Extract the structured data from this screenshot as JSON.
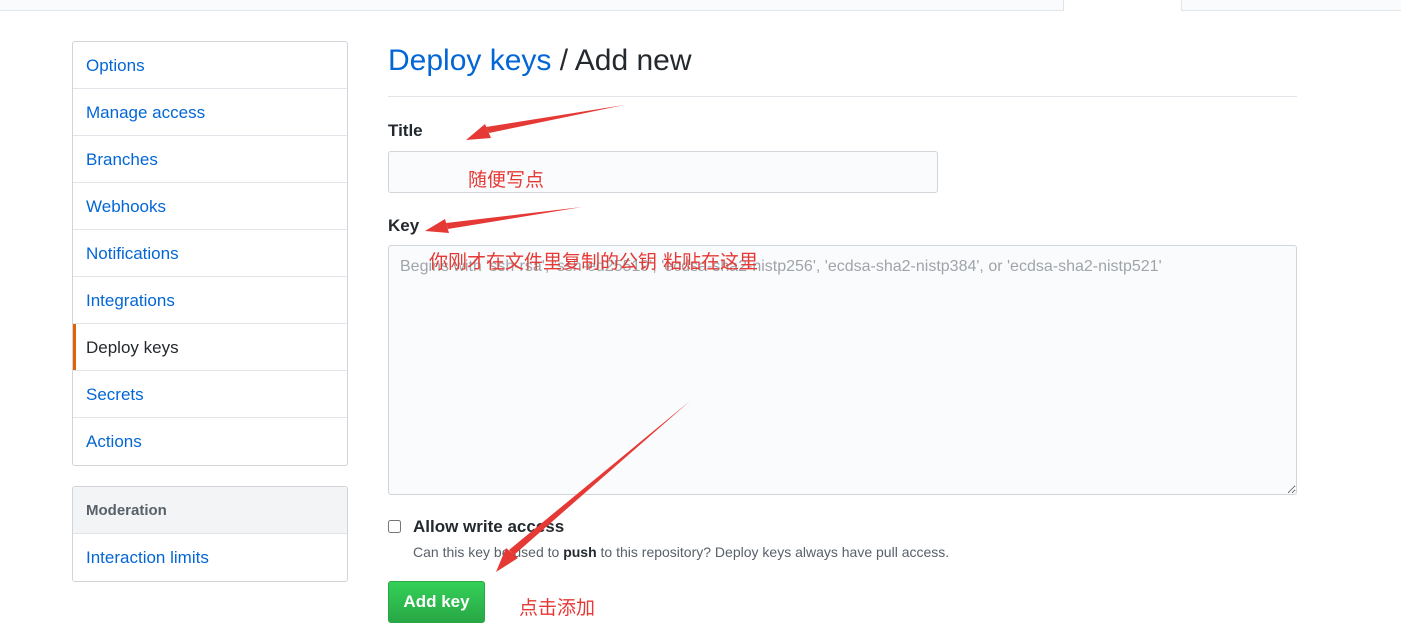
{
  "sidebar": {
    "items": [
      {
        "label": "Options"
      },
      {
        "label": "Manage access"
      },
      {
        "label": "Branches"
      },
      {
        "label": "Webhooks"
      },
      {
        "label": "Notifications"
      },
      {
        "label": "Integrations"
      },
      {
        "label": "Deploy keys"
      },
      {
        "label": "Secrets"
      },
      {
        "label": "Actions"
      }
    ],
    "selected": "Deploy keys",
    "moderation": {
      "heading": "Moderation",
      "items": [
        {
          "label": "Interaction limits"
        }
      ]
    }
  },
  "main": {
    "breadcrumb": "Deploy keys",
    "separator": "/",
    "title": "Add new",
    "title_field": {
      "label": "Title",
      "value": ""
    },
    "key_field": {
      "label": "Key",
      "placeholder": "Begins with 'ssh-rsa', 'ssh-ed25519', 'ecdsa-sha2-nistp256', 'ecdsa-sha2-nistp384', or 'ecdsa-sha2-nistp521'",
      "value": ""
    },
    "write_access": {
      "label": "Allow write access",
      "checked": false,
      "note_prefix": "Can this key be used to",
      "note_bold": "push",
      "note_suffix": "to this repository? Deploy keys always have pull access."
    },
    "submit_label": "Add key"
  },
  "annotations": {
    "title_hint": "随便写点",
    "key_hint": "你刚才在文件里复制的公钥 粘贴在这里",
    "submit_hint": "点击添加",
    "color": "#e53935"
  },
  "colors": {
    "link": "#0366d6",
    "selected_marker": "#e36209",
    "button_green": "#28a745"
  }
}
